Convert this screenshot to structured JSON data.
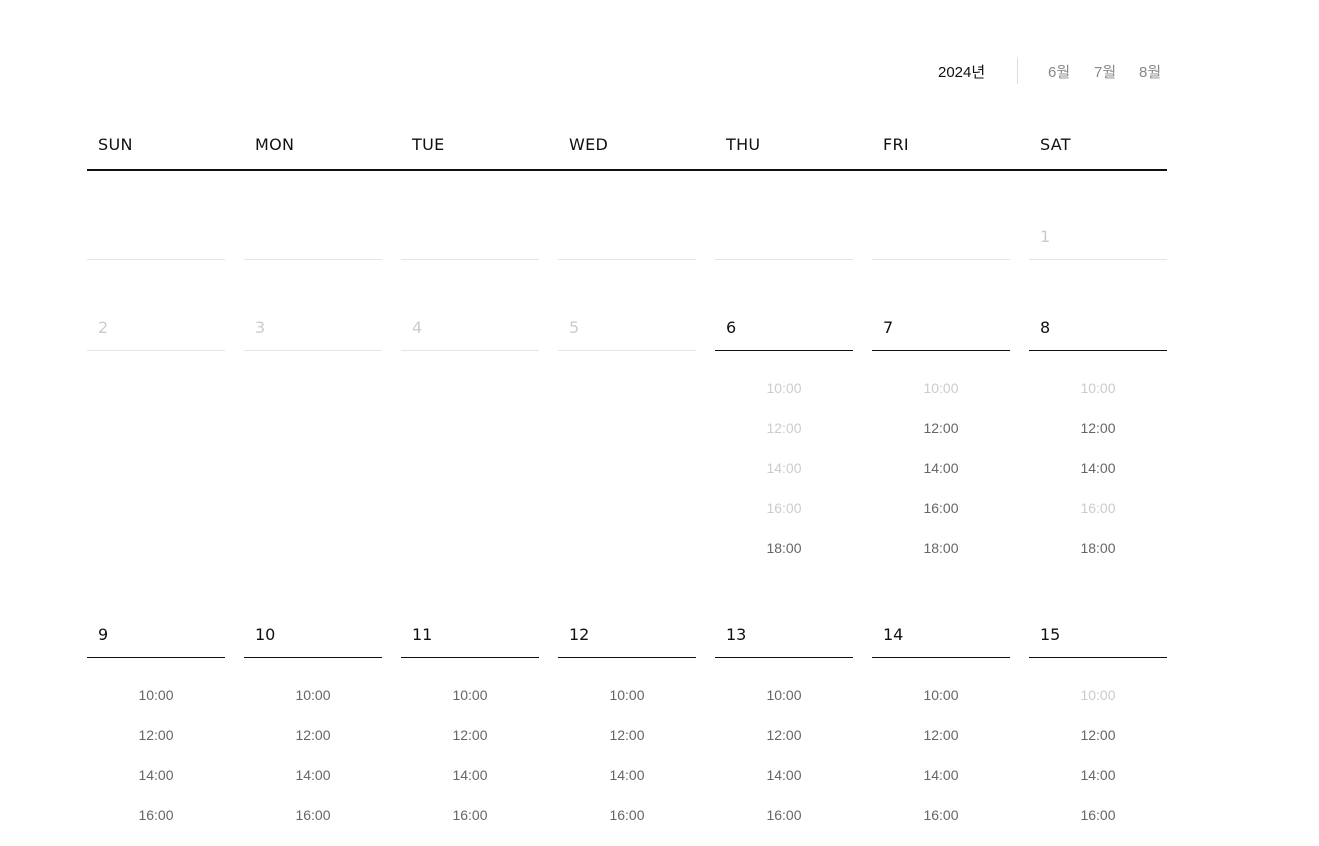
{
  "header": {
    "year": "2024년",
    "months": [
      "6월",
      "7월",
      "8월"
    ],
    "active_month_index": 0
  },
  "weekdays": [
    "SUN",
    "MON",
    "TUE",
    "WED",
    "THU",
    "FRI",
    "SAT"
  ],
  "colors": {
    "text": "#111111",
    "slot_available": "#666666",
    "slot_disabled": "#cccccc",
    "divider": "#e5e5e5"
  },
  "weeks": [
    {
      "days": [
        {
          "day": "",
          "disabled": true
        },
        {
          "day": "",
          "disabled": true
        },
        {
          "day": "",
          "disabled": true
        },
        {
          "day": "",
          "disabled": true
        },
        {
          "day": "",
          "disabled": true
        },
        {
          "day": "",
          "disabled": true
        },
        {
          "day": "1",
          "disabled": true
        }
      ]
    },
    {
      "days": [
        {
          "day": "2",
          "disabled": true
        },
        {
          "day": "3",
          "disabled": true
        },
        {
          "day": "4",
          "disabled": true
        },
        {
          "day": "5",
          "disabled": true
        },
        {
          "day": "6",
          "disabled": false,
          "slots": [
            {
              "time": "10:00",
              "available": false
            },
            {
              "time": "12:00",
              "available": false
            },
            {
              "time": "14:00",
              "available": false
            },
            {
              "time": "16:00",
              "available": false
            },
            {
              "time": "18:00",
              "available": true
            }
          ]
        },
        {
          "day": "7",
          "disabled": false,
          "slots": [
            {
              "time": "10:00",
              "available": false
            },
            {
              "time": "12:00",
              "available": true
            },
            {
              "time": "14:00",
              "available": true
            },
            {
              "time": "16:00",
              "available": true
            },
            {
              "time": "18:00",
              "available": true
            }
          ]
        },
        {
          "day": "8",
          "disabled": false,
          "slots": [
            {
              "time": "10:00",
              "available": false
            },
            {
              "time": "12:00",
              "available": true
            },
            {
              "time": "14:00",
              "available": true
            },
            {
              "time": "16:00",
              "available": false
            },
            {
              "time": "18:00",
              "available": true
            }
          ]
        }
      ]
    },
    {
      "days": [
        {
          "day": "9",
          "disabled": false,
          "slots": [
            {
              "time": "10:00",
              "available": true
            },
            {
              "time": "12:00",
              "available": true
            },
            {
              "time": "14:00",
              "available": true
            },
            {
              "time": "16:00",
              "available": true
            }
          ]
        },
        {
          "day": "10",
          "disabled": false,
          "slots": [
            {
              "time": "10:00",
              "available": true
            },
            {
              "time": "12:00",
              "available": true
            },
            {
              "time": "14:00",
              "available": true
            },
            {
              "time": "16:00",
              "available": true
            }
          ]
        },
        {
          "day": "11",
          "disabled": false,
          "slots": [
            {
              "time": "10:00",
              "available": true
            },
            {
              "time": "12:00",
              "available": true
            },
            {
              "time": "14:00",
              "available": true
            },
            {
              "time": "16:00",
              "available": true
            }
          ]
        },
        {
          "day": "12",
          "disabled": false,
          "slots": [
            {
              "time": "10:00",
              "available": true
            },
            {
              "time": "12:00",
              "available": true
            },
            {
              "time": "14:00",
              "available": true
            },
            {
              "time": "16:00",
              "available": true
            }
          ]
        },
        {
          "day": "13",
          "disabled": false,
          "slots": [
            {
              "time": "10:00",
              "available": true
            },
            {
              "time": "12:00",
              "available": true
            },
            {
              "time": "14:00",
              "available": true
            },
            {
              "time": "16:00",
              "available": true
            }
          ]
        },
        {
          "day": "14",
          "disabled": false,
          "slots": [
            {
              "time": "10:00",
              "available": true
            },
            {
              "time": "12:00",
              "available": true
            },
            {
              "time": "14:00",
              "available": true
            },
            {
              "time": "16:00",
              "available": true
            }
          ]
        },
        {
          "day": "15",
          "disabled": false,
          "slots": [
            {
              "time": "10:00",
              "available": false
            },
            {
              "time": "12:00",
              "available": true
            },
            {
              "time": "14:00",
              "available": true
            },
            {
              "time": "16:00",
              "available": true
            }
          ]
        }
      ]
    }
  ]
}
